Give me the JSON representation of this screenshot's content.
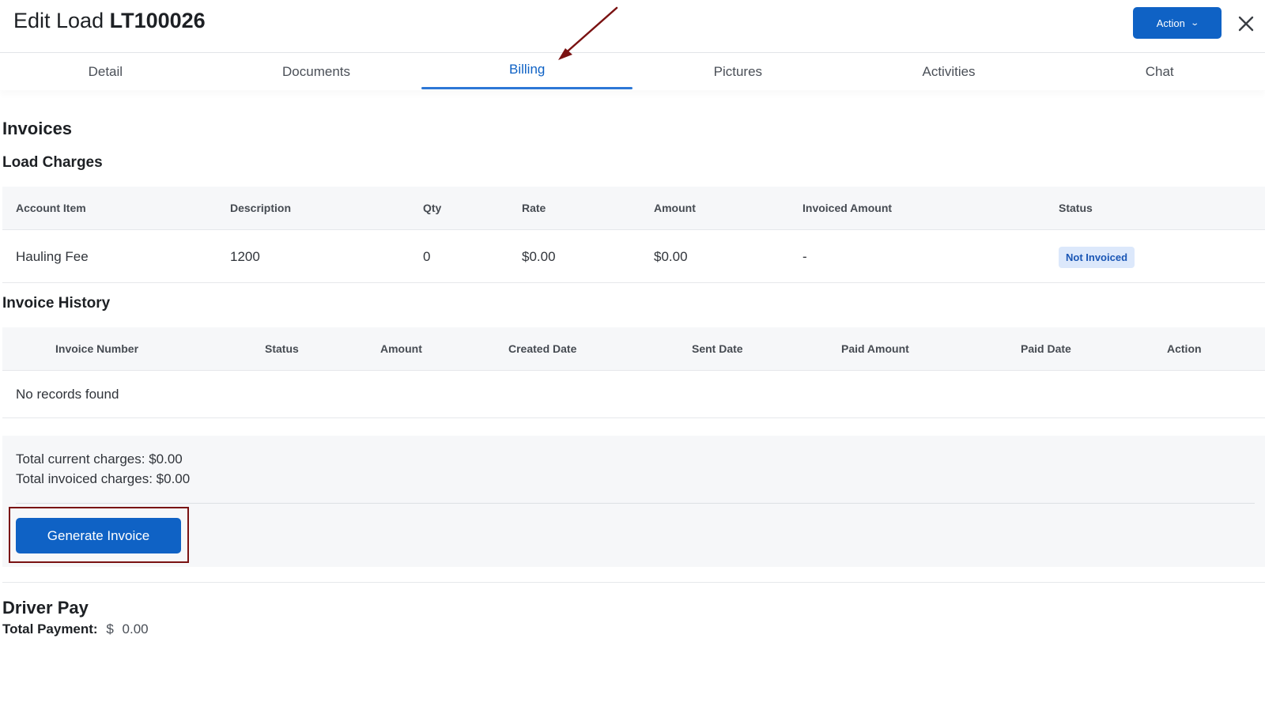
{
  "header": {
    "title_prefix": "Edit Load",
    "load_id": "LT100026",
    "action_label": "Action",
    "action_icon": "chevron-down-icon",
    "close_icon": "close-icon"
  },
  "tabs": [
    {
      "label": "Detail",
      "active": false
    },
    {
      "label": "Documents",
      "active": false
    },
    {
      "label": "Billing",
      "active": true
    },
    {
      "label": "Pictures",
      "active": false
    },
    {
      "label": "Activities",
      "active": false
    },
    {
      "label": "Chat",
      "active": false
    }
  ],
  "invoices": {
    "heading": "Invoices",
    "load_charges": {
      "heading": "Load Charges",
      "columns": [
        "Account Item",
        "Description",
        "Qty",
        "Rate",
        "Amount",
        "Invoiced Amount",
        "Status"
      ],
      "rows": [
        {
          "account_item": "Hauling Fee",
          "description": "1200",
          "qty": "0",
          "rate": "$0.00",
          "amount": "$0.00",
          "invoiced_amount": "-",
          "status": "Not Invoiced"
        }
      ]
    },
    "invoice_history": {
      "heading": "Invoice History",
      "columns": [
        "Invoice Number",
        "Status",
        "Amount",
        "Created Date",
        "Sent Date",
        "Paid Amount",
        "Paid Date",
        "Action"
      ],
      "empty_message": "No records found"
    },
    "totals": {
      "current": "Total current charges: $0.00",
      "invoiced": "Total invoiced charges: $0.00"
    },
    "generate_label": "Generate Invoice"
  },
  "driver_pay": {
    "heading": "Driver Pay",
    "total_label": "Total Payment:",
    "currency": "$",
    "total_value": "0.00"
  },
  "colors": {
    "primary": "#0f62c5",
    "badge_bg": "#dce8fb",
    "annotation": "#7a1212"
  }
}
